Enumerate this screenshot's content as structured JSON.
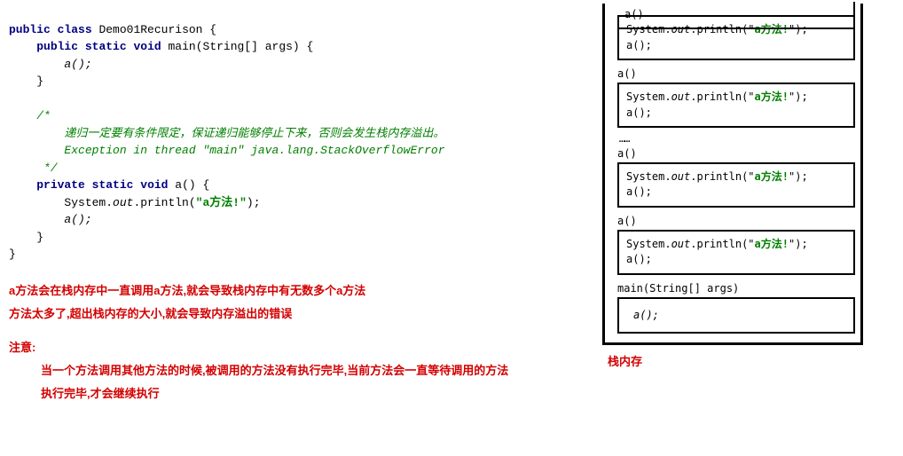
{
  "code": {
    "line2_kw1": "public",
    "line2_kw2": "class",
    "line2_cls": "Demo01Recurison",
    "line2_brace": " {",
    "line3_kw1": "public",
    "line3_kw2": "static",
    "line3_kw3": "void",
    "line3_main": "main",
    "line3_sig": "(String[] args) {",
    "line4_call": "a();",
    "line5_brace": "}",
    "line7_comment_open": "/*",
    "line8_comment": "递归一定要有条件限定，保证递归能够停止下来，否则会发生栈内存溢出。",
    "line9_comment": "Exception in thread \"main\" java.lang.StackOverflowError",
    "line10_comment_close": " */",
    "line11_kw1": "private",
    "line11_kw2": "static",
    "line11_kw3": "void",
    "line11_method": "a",
    "line11_sig": "() {",
    "line12_sys": "System.",
    "line12_out": "out",
    "line12_print": ".println(",
    "line12_str_q1": "\"",
    "line12_str_cn": "a方法!",
    "line12_str_q2": "\"",
    "line12_end": ");",
    "line13_call": "a();",
    "line14_brace": "}",
    "line15_brace": "}"
  },
  "notes": {
    "n1": "a方法会在栈内存中一直调用a方法,就会导致栈内存中有无数多个a方法",
    "n2": "方法太多了,超出栈内存的大小,就会导致内存溢出的错误",
    "n3": "注意:",
    "n4": "当一个方法调用其他方法的时候,被调用的方法没有执行完毕,当前方法会一直等待调用的方法",
    "n5": "执行完毕,才会继续执行"
  },
  "diagram": {
    "partial_label": "a()",
    "frame_label_a": "a()",
    "body_sys": "System.",
    "body_out": "out",
    "body_print": ".println(",
    "body_q1": "\"",
    "body_cn": "a方法!",
    "body_q2": "\"",
    "body_end": ");",
    "body_call": "a();",
    "ellipsis": "……",
    "main_label": "main(String[] args)",
    "main_body": "a();",
    "caption": "栈内存"
  }
}
